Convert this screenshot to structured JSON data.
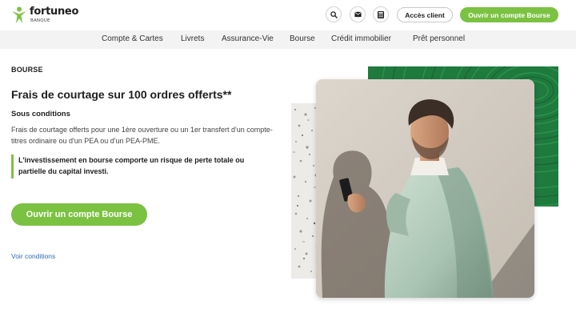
{
  "header": {
    "logo_name": "fortuneo",
    "logo_sub": "BANQUE",
    "acces_client": "Accès client",
    "ouvrir_compte": "Ouvrir un compte Bourse",
    "icons": [
      "search-icon",
      "mail-icon",
      "calculator-icon"
    ]
  },
  "nav": {
    "items": [
      "Compte & Cartes",
      "Livrets",
      "Assurance-Vie",
      "Bourse",
      "Crédit immobilier",
      "Prêt personnel"
    ]
  },
  "main": {
    "section_label": "BOURSE",
    "headline": "Frais de courtage sur 100 ordres offerts**",
    "subhead": "Sous conditions",
    "description": "Frais de courtage offerts pour une 1ère ouverture ou un 1er transfert d'un compte-titres ordinaire ou d'un PEA ou d'un PEA-PME.",
    "warning_line1": "L'investissement en bourse comporte un risque de perte totale ou",
    "warning_line2": "partielle du capital investi.",
    "cta": "Ouvrir un compte Bourse",
    "conditions_link": "Voir conditions"
  },
  "colors": {
    "accent": "#7cc242",
    "link": "#2a6fb5",
    "nav_bg": "#f3f3f3"
  }
}
